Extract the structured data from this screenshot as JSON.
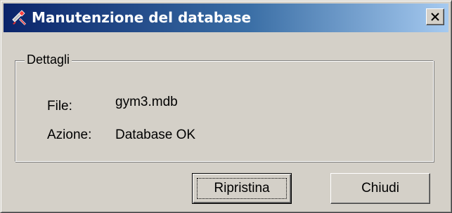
{
  "window": {
    "title": "Manutenzione del database",
    "app_icon": "database-tools-icon",
    "close_icon": "close-icon"
  },
  "details": {
    "group_label": "Dettagli",
    "file_label": "File:",
    "file_value": "gym3.mdb",
    "action_label": "Azione:",
    "action_value": "Database OK"
  },
  "buttons": {
    "restore_label": "Ripristina",
    "close_label": "Chiudi"
  },
  "colors": {
    "title_gradient_start": "#0a246a",
    "title_gradient_end": "#a6caf0",
    "face": "#d4d0c8"
  }
}
